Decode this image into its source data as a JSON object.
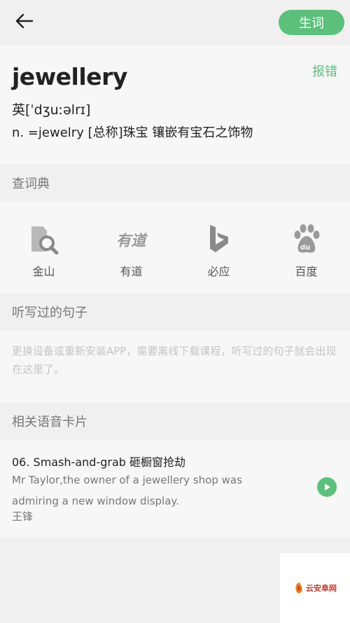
{
  "header": {
    "vocab_button": "生词"
  },
  "word_card": {
    "word": "jewellery",
    "report_label": "报错",
    "phonetic": "英[ˈdʒuːəlrɪ]",
    "definition": "n. =jewelry  [总称]珠宝 镶嵌有宝石之饰物"
  },
  "dictionary_section": {
    "title": "查词典",
    "items": [
      {
        "label": "金山",
        "icon": "jinshan-icon"
      },
      {
        "label": "有道",
        "icon": "youdao-icon"
      },
      {
        "label": "必应",
        "icon": "bing-icon"
      },
      {
        "label": "百度",
        "icon": "baidu-icon"
      }
    ]
  },
  "dictation_section": {
    "title": "听写过的句子",
    "empty_message": "更换设备或重新安装APP，需要离线下载课程，听写过的句子就会出现在这里了。"
  },
  "cards_section": {
    "title": "相关语音卡片",
    "card": {
      "title": "06. Smash-and-grab 砸橱窗抢劫",
      "description": "Mr Taylor,the owner of a jewellery shop was admiring a new window display.",
      "author": "王锋"
    }
  },
  "watermark": {
    "text": "云安阜网"
  },
  "colors": {
    "accent": "#5cbf7c",
    "background": "#f0f0f0",
    "card": "#f7f7f7"
  }
}
